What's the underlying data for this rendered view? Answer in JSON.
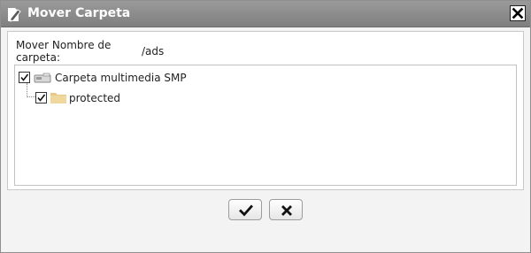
{
  "dialog": {
    "title": "Mover Carpeta",
    "title_icon": "pencil-doc-icon",
    "close_icon": "close-icon"
  },
  "form": {
    "name_label": "Mover Nombre de carpeta:",
    "name_value": "/ads"
  },
  "tree": {
    "root": {
      "label": "Carpeta multimedia SMP",
      "icon": "media-drive-icon",
      "checked": true
    },
    "children": [
      {
        "label": "protected",
        "icon": "folder-icon",
        "checked": true
      }
    ]
  },
  "buttons": {
    "confirm_icon": "checkmark-icon",
    "cancel_icon": "x-icon"
  }
}
